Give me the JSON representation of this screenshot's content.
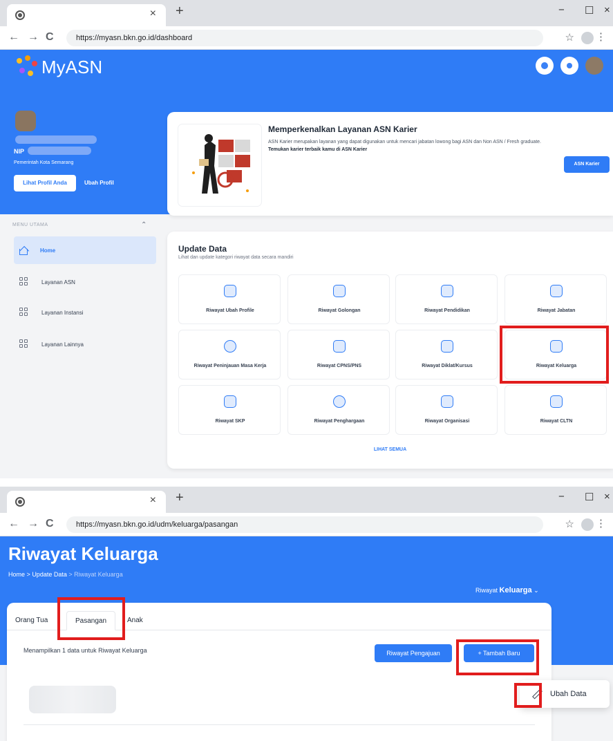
{
  "colors": {
    "brand_blue": "#2f7cf6",
    "highlight_red": "#e11d1d"
  },
  "screen1": {
    "browser": {
      "url": "https://myasn.bkn.go.id/dashboard"
    },
    "logo_text": "MyASN",
    "profile": {
      "nip_label": "NIP",
      "org": "Pemerintah Kota Semarang",
      "view_profile": "Lihat Profil Anda",
      "edit_profile": "Ubah Profil"
    },
    "menu": {
      "header": "MENU UTAMA",
      "items": [
        {
          "label": "Home",
          "icon": "home-icon"
        },
        {
          "label": "Layanan ASN",
          "icon": "grid-icon"
        },
        {
          "label": "Layanan Instansi",
          "icon": "grid-icon"
        },
        {
          "label": "Layanan Lainnya",
          "icon": "grid-icon"
        }
      ]
    },
    "promo": {
      "title": "Memperkenalkan Layanan ASN Karier",
      "desc_plain": "ASN Karier merupakan layanan yang dapat digunakan untuk mencari jabatan lowong bagi ASN dan Non ASN / Fresh graduate. ",
      "desc_bold": "Temukan karier terbaik kamu di ASN Karier",
      "button": "ASN Karier"
    },
    "update": {
      "title": "Update Data",
      "subtitle": "Lihat dan update kategori riwayat data secara mandiri",
      "tiles": [
        "Riwayat Ubah Profile",
        "Riwayat Golongan",
        "Riwayat Pendidikan",
        "Riwayat Jabatan",
        "Riwayat Peninjauan Masa Kerja",
        "Riwayat CPNS/PNS",
        "Riwayat Diklat/Kursus",
        "Riwayat Keluarga",
        "Riwayat SKP",
        "Riwayat Penghargaan",
        "Riwayat Organisasi",
        "Riwayat CLTN"
      ],
      "see_all": "LIHAT SEMUA"
    }
  },
  "screen2": {
    "browser": {
      "url": "https://myasn.bkn.go.id/udm/keluarga/pasangan"
    },
    "title": "Riwayat Keluarga",
    "breadcrumb": {
      "home": "Home",
      "sep": ">",
      "update": "Update Data",
      "current": "Riwayat Keluarga"
    },
    "selector": {
      "prefix": "Riwayat",
      "bold": "Keluarga",
      "chevron": "⌄"
    },
    "tabs": [
      "Orang Tua",
      "Pasangan",
      "Anak"
    ],
    "showing": "Menampilkan 1 data untuk Riwayat Keluarga",
    "btn_pengajuan": "Riwayat Pengajuan",
    "btn_tambah": "+ Tambah Baru",
    "row_menu": "⋮",
    "menu_item": "Ubah Data"
  },
  "chrome": {
    "close": "×",
    "newtab": "+",
    "back": "←",
    "forward": "→",
    "reload": "C",
    "star": "☆",
    "minimize": "−",
    "maximize": "☐",
    "winclose": "×",
    "more": "⋮"
  }
}
